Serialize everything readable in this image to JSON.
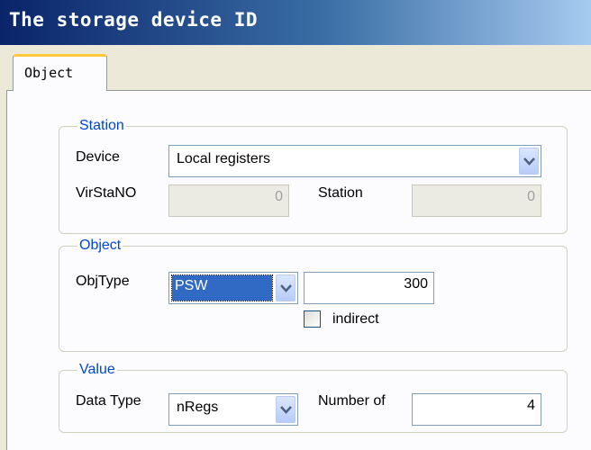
{
  "window": {
    "title": "The storage device ID"
  },
  "tabs": [
    {
      "label": "Object",
      "active": true
    }
  ],
  "station": {
    "legend": "Station",
    "device_label": "Device",
    "device_value": "Local registers",
    "virstano_label": "VirStaNO",
    "virstano_value": "0",
    "station_label": "Station",
    "station_value": "0"
  },
  "object": {
    "legend": "Object",
    "objtype_label": "ObjType",
    "objtype_value": "PSW",
    "address_value": "300",
    "indirect_label": "indirect",
    "indirect_checked": false
  },
  "value": {
    "legend": "Value",
    "datatype_label": "Data Type",
    "datatype_value": "nRegs",
    "number_label": "Number of",
    "number_value": "4"
  },
  "colors": {
    "legend": "#0046d5",
    "selection": "#316ac5",
    "tab_accent": "#ffc83c"
  },
  "icons": {
    "dropdown": "chevron-down-icon"
  }
}
